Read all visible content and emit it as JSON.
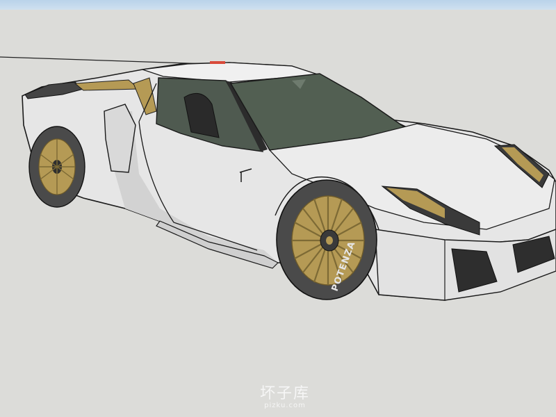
{
  "scene": {
    "watermark_main": "坏子库",
    "watermark_sub": "pizku.com",
    "tire_brand": "POTENZA",
    "colors": {
      "sky": "#c4dbee",
      "ground": "#dcdcd9",
      "body": "#e9e9e9",
      "body_shade": "#d3d3d3",
      "accent_gold": "#b59a55",
      "glass": "#4d5c4d",
      "carbon": "#3a3a3a"
    }
  }
}
